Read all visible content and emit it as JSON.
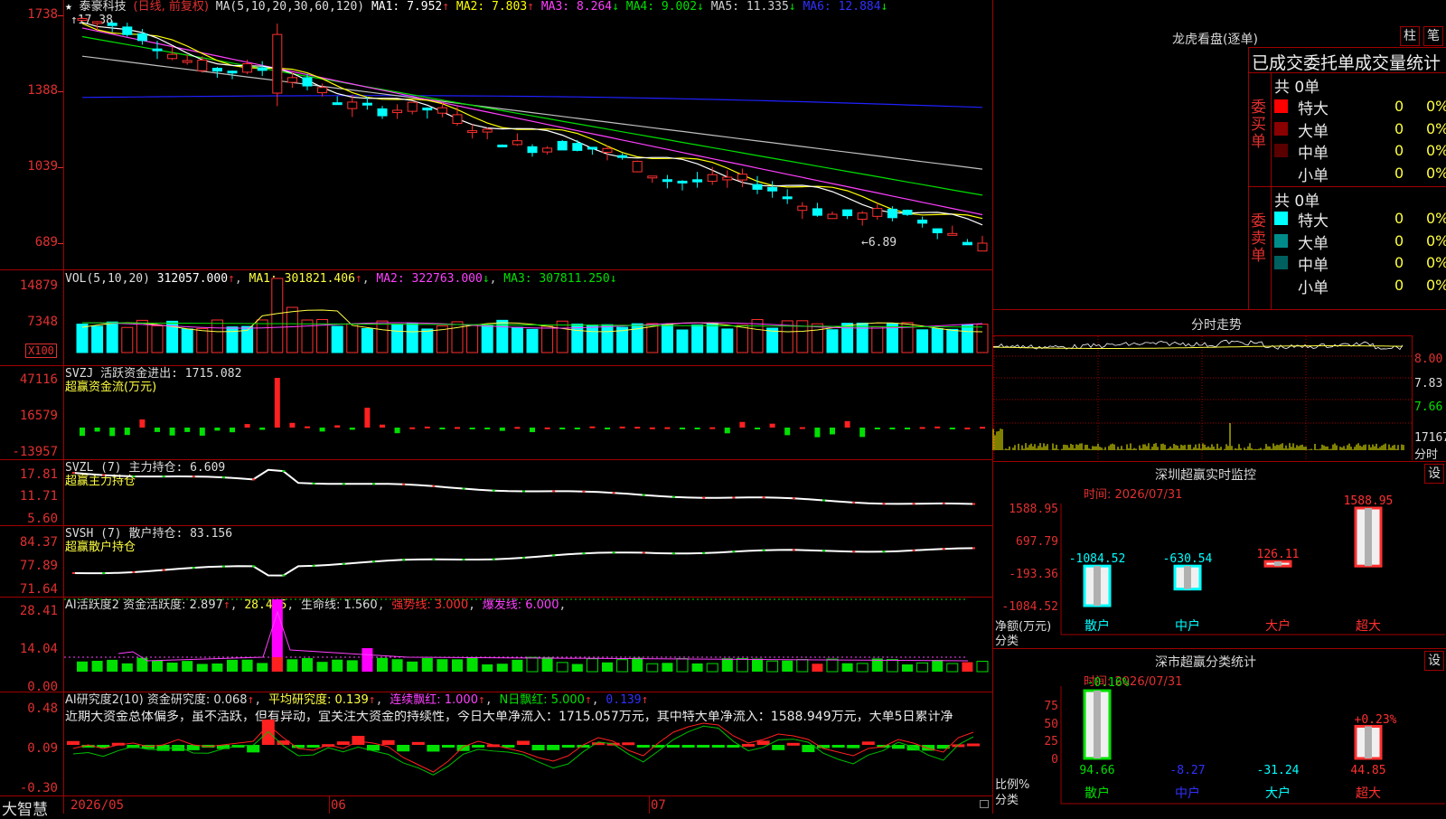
{
  "main": {
    "star": "★",
    "stock_name": "泰豪科技",
    "period": "(日线, 前复权)",
    "ma_label": "MA(5,10,20,30,60,120)",
    "ma1": "MA1: 7.952",
    "ma2": "MA2: 7.803",
    "ma3": "MA3: 8.264",
    "ma4": "MA4: 9.002",
    "ma5": "MA5: 11.335",
    "ma6": "MA6: 12.884",
    "arrow_up": "↑",
    "arrow_down": "↓",
    "high_marker": "17.38",
    "low_marker": "←6.89",
    "axis": [
      "1738",
      "1388",
      "1039",
      "689"
    ],
    "colors": {
      "ma1": "#ffffff",
      "ma2": "#ffff00",
      "ma3": "#ff40ff",
      "ma4": "#00e000",
      "ma5": "#c0c0c0",
      "ma6": "#2020ff"
    }
  },
  "vol": {
    "label": "VOL(5,10,20)",
    "value": "312057.000",
    "ma1": "MA1: 301821.406",
    "ma2": "MA2: 322763.000",
    "ma3": "MA3: 307811.250",
    "axis": [
      "14879",
      "7348"
    ],
    "unit": "X100"
  },
  "svzj": {
    "label": "SVZJ  活跃资金进出: 1715.082",
    "subtitle": "超赢资金流(万元)",
    "axis": [
      "47116",
      "16579",
      "-13957"
    ]
  },
  "svzl": {
    "label": "SVZL (7) 主力持仓: 6.609",
    "subtitle": "超赢主力持仓",
    "axis": [
      "17.81",
      "11.71",
      "5.60"
    ]
  },
  "svsh": {
    "label": "SVSH (7) 散户持仓: 83.156",
    "subtitle": "超赢散户持仓",
    "axis": [
      "84.37",
      "77.89",
      "71.64"
    ]
  },
  "ai_active": {
    "label": "AI活跃度2 资金活跃度: 2.897",
    "v2": "28.415",
    "life": "生命线: 1.560",
    "strong": "强势线: 3.000",
    "burst": "爆发线: 6.000",
    "axis": [
      "28.41",
      "14.04",
      "0.00"
    ]
  },
  "ai_research": {
    "label": "AI研究度2(10) 资金研究度: 0.068",
    "avg": "平均研究度: 0.139",
    "consec": "连续飘红: 1.000",
    "ndays": "N日飘红: 5.000",
    "last": "0.139",
    "comment": "近期大资金总体偏多，虽不活跃，但有异动，宜关注大资金的持续性，今日大单净流入：1715.057万元，其中特大单净流入：1588.949万元，大单5日累计净",
    "axis": [
      "0.48",
      "0.09",
      "-0.30"
    ]
  },
  "footer": {
    "brand": "大智慧",
    "dates": [
      "2026/05",
      "06",
      "07"
    ]
  },
  "dragon": {
    "title": "龙虎看盘(逐单)",
    "btn_bar": "柱",
    "btn_pen": "笔",
    "tabs": "已成交委托单成交量统计",
    "buy_label": "委买单",
    "sell_label": "委卖单",
    "buy_total": "共 0单",
    "sell_total": "共 0单",
    "rows": [
      "特大",
      "大单",
      "中单",
      "小单"
    ],
    "counts": [
      "0",
      "0",
      "0",
      "0"
    ],
    "pcts": [
      "0%",
      "0%",
      "0%",
      "0%"
    ],
    "buy_colors": [
      "#ff0000",
      "#8b0000",
      "#5a0000",
      "#000000"
    ],
    "sell_colors": [
      "#00ffff",
      "#008b8b",
      "#006060",
      "#000000"
    ]
  },
  "intraday": {
    "title": "分时走势",
    "axis": [
      "8.00",
      "7.83",
      "7.66"
    ],
    "vol_axis": "17167",
    "tag": "分时"
  },
  "sz_monitor": {
    "title": "深圳超赢实时监控",
    "btn": "设",
    "time": "时间: 2026/07/31",
    "axis": [
      "1588.95",
      "697.79",
      "-193.36",
      "-1084.52"
    ],
    "y_label": "净额(万元)",
    "x_label": "分类",
    "categories": [
      "散户",
      "中户",
      "大户",
      "超大"
    ],
    "values": [
      -1084.52,
      -630.54,
      126.11,
      1588.95
    ],
    "value_labels": [
      "-1084.52",
      "-630.54",
      "126.11",
      "1588.95"
    ]
  },
  "sz_class": {
    "title": "深市超赢分类统计",
    "btn": "设",
    "time": "时间: 2026/07/31",
    "axis": [
      "75",
      "50",
      "25",
      "0"
    ],
    "y_label": "比例%",
    "x_label": "分类",
    "top_labels": [
      "-0.16%",
      "+0.23%"
    ],
    "categories": [
      "散户",
      "中户",
      "大户",
      "超大"
    ],
    "bottom_values": [
      "94.66",
      "-8.27",
      "-31.24",
      "44.85"
    ],
    "ratios": [
      94.66,
      0,
      0,
      44.85
    ]
  }
}
